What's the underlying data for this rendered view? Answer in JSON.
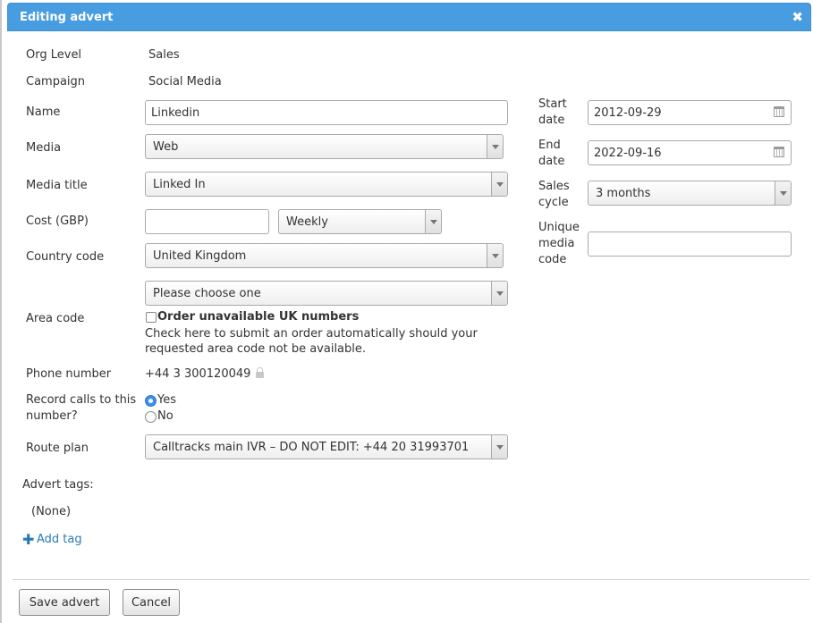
{
  "dialog": {
    "title": "Editing advert",
    "close_glyph": "✖"
  },
  "form": {
    "org_level": {
      "label": "Org Level",
      "value": "Sales"
    },
    "campaign": {
      "label": "Campaign",
      "value": "Social Media"
    },
    "name": {
      "label": "Name",
      "value": "Linkedin"
    },
    "media": {
      "label": "Media",
      "value": "Web"
    },
    "media_title": {
      "label": "Media title",
      "value": "Linked In"
    },
    "cost": {
      "label": "Cost (GBP)",
      "value": "",
      "frequency": "Weekly"
    },
    "country_code": {
      "label": "Country code",
      "value": "United Kingdom"
    },
    "area_code": {
      "label": "Area code",
      "value": "Please choose one",
      "order_label": "Order unavailable UK numbers",
      "order_help_line1": "Check here to submit an order automatically should your",
      "order_help_line2": "requested area code not be available."
    },
    "phone_number": {
      "label": "Phone number",
      "value": "+44 3 300120049"
    },
    "record_calls": {
      "label_line1": "Record calls to this",
      "label_line2": "number?",
      "yes": "Yes",
      "no": "No",
      "selected": "Yes"
    },
    "route_plan": {
      "label": "Route plan",
      "value": "Calltracks main IVR – DO NOT EDIT: +44 20 31993701"
    },
    "start_date": {
      "label_line1": "Start",
      "label_line2": "date",
      "value": "2012-09-29"
    },
    "end_date": {
      "label_line1": "End",
      "label_line2": "date",
      "value": "2022-09-16"
    },
    "sales_cycle": {
      "label_line1": "Sales",
      "label_line2": "cycle",
      "value": "3 months"
    },
    "unique_media_code": {
      "label_line1": "Unique",
      "label_line2": "media",
      "label_line3": "code",
      "value": ""
    }
  },
  "tags": {
    "label": "Advert tags:",
    "none_text": "(None)",
    "add_tag": "Add tag",
    "plus_glyph": "✚"
  },
  "buttons": {
    "save": "Save advert",
    "cancel": "Cancel"
  },
  "colors": {
    "titlebar": "#479de0",
    "link": "#2a7ab8",
    "radio_selected": "#3d8ee8"
  }
}
